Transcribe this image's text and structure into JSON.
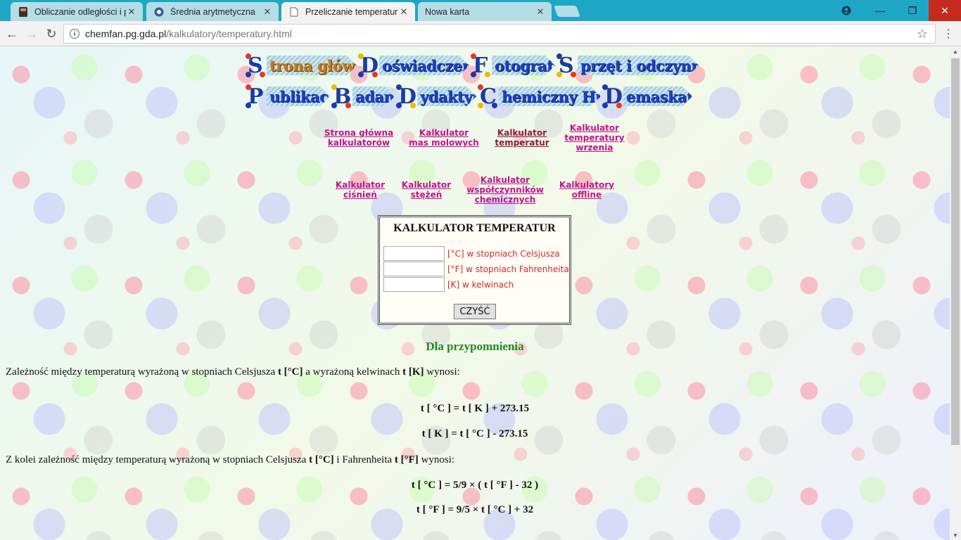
{
  "browser": {
    "tabs": [
      {
        "title": "Obliczanie odległości i p",
        "active": false,
        "icon": "calculator-icon"
      },
      {
        "title": "Średnia arytmetyczna",
        "active": false,
        "icon": "blue-globe-icon"
      },
      {
        "title": "Przeliczanie temperatur",
        "active": true,
        "icon": "page-icon"
      },
      {
        "title": "Nowa karta",
        "active": false,
        "icon": ""
      }
    ],
    "url_host": "chemfan.pg.gda.pl",
    "url_path": "/kalkulatory/temperatury.html"
  },
  "nav_buttons_row1": [
    {
      "letter": "S",
      "label": "trona główna"
    },
    {
      "letter": "D",
      "label": "oświadczenia"
    },
    {
      "letter": "F",
      "label": "otografie"
    },
    {
      "letter": "S",
      "label": "przęt i odczynniki"
    }
  ],
  "nav_buttons_row2": [
    {
      "letter": "P",
      "label": "ublikacje"
    },
    {
      "letter": "B",
      "label": "adania"
    },
    {
      "letter": "D",
      "label": "ydaktyka"
    },
    {
      "letter": "C",
      "label": "hemiczny Hihot"
    },
    {
      "letter": "D",
      "label": "emaskator"
    }
  ],
  "calc_links_row1": [
    {
      "l1": "Strona główna",
      "l2": "kalkulatorów",
      "l3": ""
    },
    {
      "l1": "Kalkulator",
      "l2": "mas molowych",
      "l3": ""
    },
    {
      "l1": "Kalkulator",
      "l2": "temperatur",
      "l3": ""
    },
    {
      "l1": "Kalkulator",
      "l2": "temperatury",
      "l3": "wrzenia"
    }
  ],
  "calc_links_row2": [
    {
      "l1": "Kalkulator",
      "l2": "ciśnień",
      "l3": ""
    },
    {
      "l1": "Kalkulator",
      "l2": "stężeń",
      "l3": ""
    },
    {
      "l1": "Kalkulator",
      "l2": "współczynników",
      "l3": "chemicznych"
    },
    {
      "l1": "Kalkulatory",
      "l2": "offline",
      "l3": ""
    }
  ],
  "calculator": {
    "title": "KALKULATOR TEMPERATUR",
    "celsius_label": "[°C] w stopniach Celsjusza",
    "fahrenheit_label": "[°F] w stopniach Fahrenheita",
    "kelvin_label": "[K] w kelwinach",
    "clear_button": "CZYŚĆ"
  },
  "reminder": {
    "heading": "Dla przypomnienia",
    "para1_a": "Zależność między temperaturą wyrażoną w stopniach Celsjusza ",
    "para1_b": "t [°C]",
    "para1_c": " a wyrażoną kelwinach ",
    "para1_d": "t [K]",
    "para1_e": " wynosi:",
    "formula1": "t [ °C ] = t [ K ] + 273.15",
    "formula2": "t [ K ] = t [ °C ] - 273.15",
    "para2_a": "Z kolei zależność między temperaturą wyrażoną w stopniach Celsjusza ",
    "para2_b": "t [°C]",
    "para2_c": " i Fahrenheita ",
    "para2_d": "t [°F]",
    "para2_e": " wynosi:",
    "formula3": "t [ °C ] = 5/9 × ( t [ °F ] - 32 )",
    "formula4": "t [ °F ] = 9/5 × t [ °C ] + 32"
  }
}
